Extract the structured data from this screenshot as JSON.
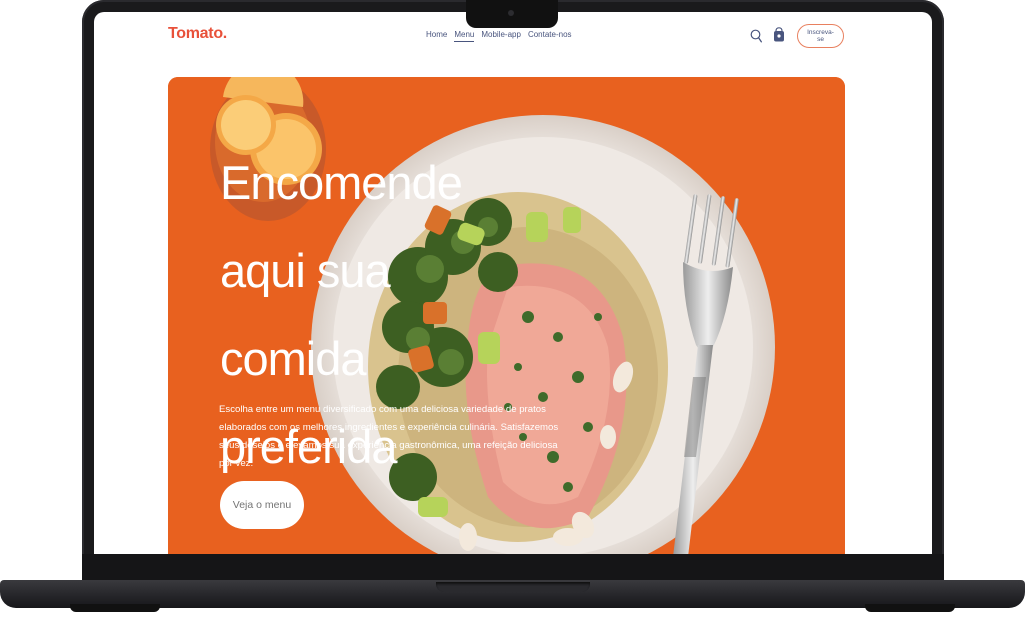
{
  "brand": {
    "logo": "Tomato.",
    "accent_color": "#e8513a",
    "hero_color": "#e8611f"
  },
  "nav": {
    "links": [
      {
        "label": "Home",
        "active": false
      },
      {
        "label": "Menu",
        "active": true
      },
      {
        "label": "Mobile-app",
        "active": false
      },
      {
        "label": "Contate-nos",
        "active": false
      }
    ],
    "icons": [
      "search-icon",
      "basket-icon"
    ],
    "signup_label": "Inscreva-se"
  },
  "hero": {
    "title": "Encomende aqui sua comida preferida",
    "description": "Escolha entre um menu diversificado com uma deliciosa variedade de pratos elaborados com os melhores ingredientes e experiência culinária. Satisfazemos seus desejos e elevamos sua experiência gastronômica, uma refeição deliciosa por vez.",
    "button_label": "Veja o menu"
  }
}
